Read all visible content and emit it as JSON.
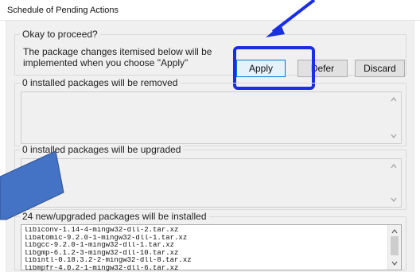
{
  "window": {
    "title": "Schedule of Pending Actions"
  },
  "proceed": {
    "heading": "Okay to proceed?",
    "message": "The package changes itemised below will be implemented when you choose \"Apply\"",
    "apply_label": "Apply",
    "defer_label": "Defer",
    "discard_label": "Discard"
  },
  "removed": {
    "heading": "0 installed packages will be removed"
  },
  "upgraded": {
    "heading": "0 installed packages will be upgraded"
  },
  "installed": {
    "heading": "24 new/upgraded packages will be installed",
    "items": [
      "libiconv-1.14-4-mingw32-dll-2.tar.xz",
      "libatomic-9.2.0-1-mingw32-dll-1.tar.xz",
      "libgcc-9.2.0-1-mingw32-dll-1.tar.xz",
      "libgmp-6.1.2-3-mingw32-dll-10.tar.xz",
      "libintl-0.18.3.2-2-mingw32-dll-8.tar.xz",
      "libmpfr-4.0.2-1-mingw32-dll-6.tar.xz"
    ]
  },
  "colors": {
    "annotation_blue": "#1a2ee6",
    "annotation_arrow_fill": "#4472c4",
    "default_button_border": "#0078d7"
  }
}
